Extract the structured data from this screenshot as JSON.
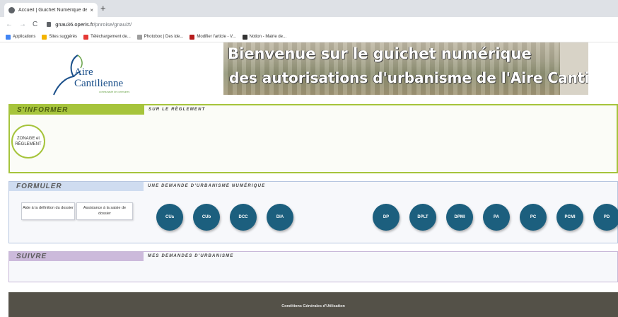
{
  "browser": {
    "tab_title": "Accueil | Guichet Numérique des",
    "tab_close": "×",
    "new_tab": "+",
    "url_host": "gnau36.operis.fr",
    "url_path": "/pnroise/gnau/#/",
    "bookmarks": [
      {
        "label": "Applications",
        "color": "#4285f4"
      },
      {
        "label": "Sites suggérés",
        "color": "#f4b400"
      },
      {
        "label": "Téléchargement de...",
        "color": "#e53935"
      },
      {
        "label": "Photobox | Des ide...",
        "color": "#9e9e9e"
      },
      {
        "label": "Modifier l'article - V...",
        "color": "#b71c1c"
      },
      {
        "label": "Notion - Mairie de...",
        "color": "#333333"
      }
    ]
  },
  "header": {
    "logo_line1": "Aire",
    "logo_line2": "Cantilienne",
    "logo_sub": "communauté de communes",
    "banner_line1": "Bienvenue sur le guichet numérique",
    "banner_line2": "des autorisations d'urbanisme de l'Aire Cantilienne"
  },
  "sections": {
    "informer": {
      "label": "S'INFORMER",
      "subtitle": "SUR LE RÈGLEMENT",
      "zonage": "ZONAGE et RÈGLEMENT"
    },
    "formuler": {
      "label": "FORMULER",
      "subtitle": "UNE DEMANDE D'URBANISME NUMÉRIQUE",
      "aide1": "Aide à la définition du dossier",
      "aide2": "Assistance à la saisie de dossier",
      "buttons": [
        "CUa",
        "CUb",
        "DCC",
        "DIA",
        "DP",
        "DPLT",
        "DPMI",
        "PA",
        "PC",
        "PCMI",
        "PD"
      ]
    },
    "suivre": {
      "label": "SUIVRE",
      "subtitle": "MES DEMANDES D'URBANISME"
    }
  },
  "footer": {
    "link": "Conditions Générales d'Utilisation"
  }
}
